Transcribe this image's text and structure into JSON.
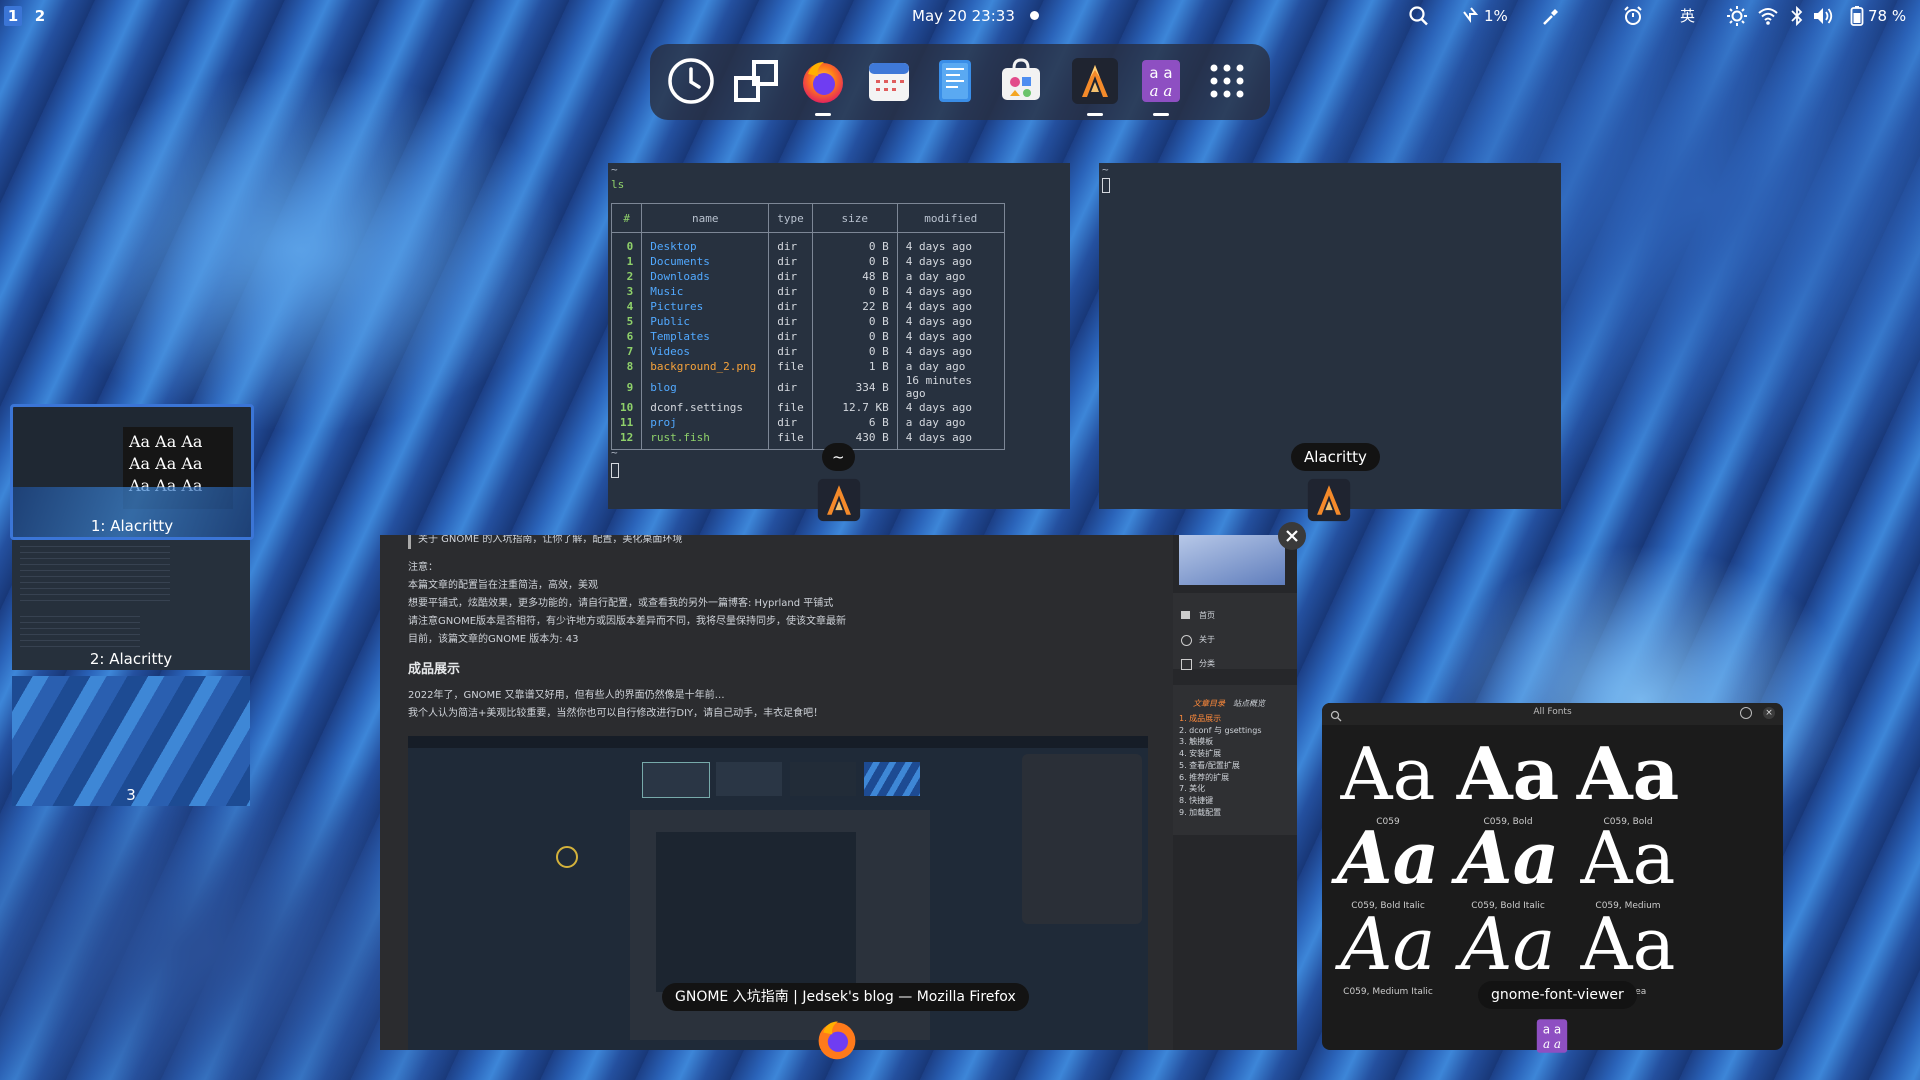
{
  "topbar": {
    "workspaces": [
      "1",
      "2"
    ],
    "clock": "May 20  23:33",
    "battery_saver_percent": "1%",
    "input_method": "英",
    "battery_percent": "78 %"
  },
  "dock": {
    "apps": [
      "clock-app",
      "connections-app",
      "firefox",
      "calendar",
      "text-editor",
      "software-center",
      "alacritty",
      "font-viewer",
      "app-grid"
    ]
  },
  "terminal1": {
    "command": "ls",
    "prompt_top": "~",
    "headers": [
      "#",
      "name",
      "type",
      "size",
      "modified"
    ],
    "rows": [
      {
        "n": "0",
        "name": "Desktop",
        "type": "dir",
        "size": "0 B",
        "mod": "4 days ago",
        "kind": "dir"
      },
      {
        "n": "1",
        "name": "Documents",
        "type": "dir",
        "size": "0 B",
        "mod": "4 days ago",
        "kind": "dir"
      },
      {
        "n": "2",
        "name": "Downloads",
        "type": "dir",
        "size": "48 B",
        "mod": "a day ago",
        "kind": "dir"
      },
      {
        "n": "3",
        "name": "Music",
        "type": "dir",
        "size": "0 B",
        "mod": "4 days ago",
        "kind": "dir"
      },
      {
        "n": "4",
        "name": "Pictures",
        "type": "dir",
        "size": "22 B",
        "mod": "4 days ago",
        "kind": "dir"
      },
      {
        "n": "5",
        "name": "Public",
        "type": "dir",
        "size": "0 B",
        "mod": "4 days ago",
        "kind": "dir"
      },
      {
        "n": "6",
        "name": "Templates",
        "type": "dir",
        "size": "0 B",
        "mod": "4 days ago",
        "kind": "dir"
      },
      {
        "n": "7",
        "name": "Videos",
        "type": "dir",
        "size": "0 B",
        "mod": "4 days ago",
        "kind": "dir"
      },
      {
        "n": "8",
        "name": "background_2.png",
        "type": "file",
        "size": "1 B",
        "mod": "a day ago",
        "kind": "png"
      },
      {
        "n": "9",
        "name": "blog",
        "type": "dir",
        "size": "334 B",
        "mod": "16 minutes ago",
        "kind": "dir"
      },
      {
        "n": "10",
        "name": "dconf.settings",
        "type": "file",
        "size": "12.7 KB",
        "mod": "4 days ago",
        "kind": "file"
      },
      {
        "n": "11",
        "name": "proj",
        "type": "dir",
        "size": "6 B",
        "mod": "a day ago",
        "kind": "dir"
      },
      {
        "n": "12",
        "name": "rust.fish",
        "type": "file",
        "size": "430 B",
        "mod": "4 days ago",
        "kind": "fish"
      }
    ],
    "prompt_bottom": "~",
    "window_label": "~"
  },
  "terminal2": {
    "prompt": "~",
    "window_label": "Alacritty"
  },
  "workspace_thumbs": [
    {
      "label": "1: Alacritty"
    },
    {
      "label": "2: Alacritty"
    },
    {
      "label": "3"
    }
  ],
  "firefox": {
    "window_label": "GNOME 入坑指南 | Jedsek's blog — Mozilla Firefox",
    "quote": "关于 GNOME 的入坑指南，让你了解，配置，美化桌面环境",
    "note_title": "注意：",
    "lines": [
      "本篇文章的配置旨在注重简洁，高效，美观",
      "想要平铺式，炫酷效果，更多功能的，请自行配置，或查看我的另外一篇博客: Hyprland 平铺式",
      "请注意GNOME版本是否相符，有少许地方或因版本差异而不同，我将尽量保持同步，使该文章最新",
      "目前，该篇文章的GNOME 版本为: 43"
    ],
    "section_title": "成品展示",
    "section_lines": [
      "2022年了，GNOME 又靠谱又好用，但有些人的界面仍然像是十年前…",
      "我个人认为简洁+美观比较重要，当然你也可以自行修改进行DIY，请自己动手，丰衣足食吧！"
    ],
    "sidebar_nav": [
      "首页",
      "关于",
      "分类"
    ],
    "toc_tabs": [
      "文章目录",
      "站点概览"
    ],
    "toc": [
      "1. 成品展示",
      "2. dconf 与 gsettings",
      "3. 触摸板",
      "4. 安装扩展",
      "5. 查看/配置扩展",
      "6. 推荐的扩展",
      "7. 美化",
      "8. 快捷键",
      "9. 加载配置"
    ]
  },
  "fontviewer": {
    "title": "All Fonts",
    "window_label": "gnome-font-viewer",
    "sample": "Aa",
    "fonts": [
      {
        "name": "C059",
        "weight": "normal",
        "style": "normal"
      },
      {
        "name": "C059, Bold",
        "weight": "bold",
        "style": "normal"
      },
      {
        "name": "C059, Bold",
        "weight": "bold",
        "style": "normal"
      },
      {
        "name": "C059, Bold Italic",
        "weight": "bold",
        "style": "italic"
      },
      {
        "name": "C059, Bold Italic",
        "weight": "bold",
        "style": "italic"
      },
      {
        "name": "C059, Medium",
        "weight": "500",
        "style": "normal"
      },
      {
        "name": "C059, Medium Italic",
        "weight": "500",
        "style": "italic"
      },
      {
        "name": "C059, Italic",
        "weight": "normal",
        "style": "italic"
      },
      {
        "name": "Caladea",
        "weight": "normal",
        "style": "normal"
      }
    ]
  },
  "colors": {
    "accent": "#3b75d6",
    "terminal_bg": "#27313f",
    "dir": "#51a9ff",
    "num": "#8fd16a",
    "png": "#f5a23b"
  }
}
